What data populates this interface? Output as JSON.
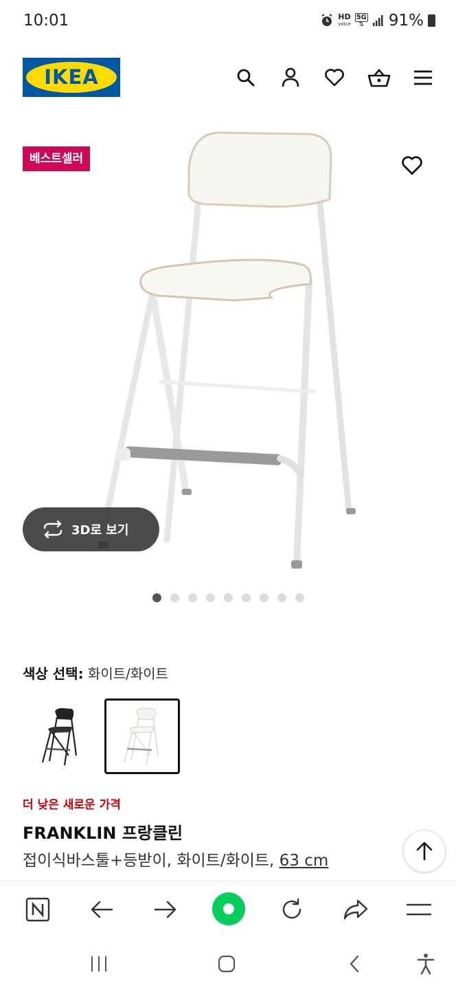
{
  "status": {
    "time": "10:01",
    "hd_label": "HD",
    "voice_label": "voice",
    "net_label": "5G",
    "battery": "91%"
  },
  "header": {
    "logo_text": "IKEA",
    "brand_blue": "#0058a3",
    "brand_yellow": "#ffdb00",
    "icons": [
      "search-icon",
      "user-icon",
      "heart-icon",
      "basket-icon",
      "menu-icon"
    ]
  },
  "product_image": {
    "badge": "베스트셀러",
    "badge_color": "#cc0a58",
    "view_3d_label": "3D로 보기",
    "image_count": 9,
    "active_image": 1
  },
  "color_select": {
    "label": "색상 선택:",
    "value": "화이트/화이트",
    "options": [
      "black",
      "white"
    ],
    "selected": "white"
  },
  "product": {
    "price_tag": "더 낮은 새로운 가격",
    "price_tag_color": "#cc0008",
    "name": "FRANKLIN 프랑클린",
    "description": "접이식바스툴+등받이, 화이트/화이트,",
    "size": "63 cm"
  },
  "browser_bar": {
    "icons": [
      "naver-icon",
      "back-icon",
      "forward-icon",
      "home-dot-icon",
      "reload-icon",
      "share-icon",
      "menu-icon"
    ],
    "accent": "#03cf5d"
  },
  "system_nav": {
    "icons": [
      "recents-icon",
      "home-icon",
      "back-icon",
      "accessibility-icon"
    ]
  }
}
